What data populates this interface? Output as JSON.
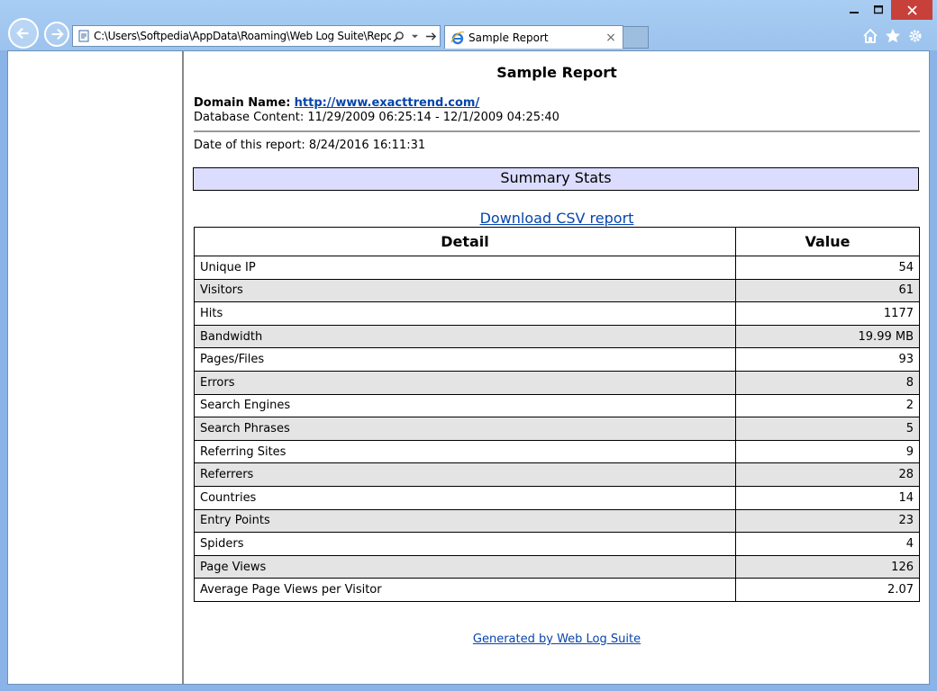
{
  "browser": {
    "address": "C:\\Users\\Softpedia\\AppData\\Roaming\\Web Log Suite\\Reports",
    "tab_title": "Sample Report",
    "tab_close": "×",
    "window": {
      "minimize": "🗕",
      "maximize": "🗖",
      "close": "✕"
    },
    "colors": {
      "frame": "#9cc3ee",
      "close": "#c7403a"
    }
  },
  "report": {
    "title": "Sample Report",
    "domain_label": "Domain Name:",
    "domain_url": "http://www.exacttrend.com/",
    "db_content": "Database Content: 11/29/2009 06:25:14 - 12/1/2009 04:25:40",
    "date_line": "Date of this report: 8/24/2016 16:11:31",
    "summary_heading": "Summary Stats",
    "csv_link": "Download CSV report",
    "columns": [
      "Detail",
      "Value"
    ],
    "rows": [
      {
        "detail": "Unique IP",
        "value": "54"
      },
      {
        "detail": "Visitors",
        "value": "61"
      },
      {
        "detail": "Hits",
        "value": "1177"
      },
      {
        "detail": "Bandwidth",
        "value": "19.99 MB"
      },
      {
        "detail": "Pages/Files",
        "value": "93"
      },
      {
        "detail": "Errors",
        "value": "8"
      },
      {
        "detail": "Search Engines",
        "value": "2"
      },
      {
        "detail": "Search Phrases",
        "value": "5"
      },
      {
        "detail": "Referring Sites",
        "value": "9"
      },
      {
        "detail": "Referrers",
        "value": "28"
      },
      {
        "detail": "Countries",
        "value": "14"
      },
      {
        "detail": "Entry Points",
        "value": "23"
      },
      {
        "detail": "Spiders",
        "value": "4"
      },
      {
        "detail": "Page Views",
        "value": "126"
      },
      {
        "detail": "Average Page Views per Visitor",
        "value": "2.07"
      }
    ],
    "footer": "Generated by Web Log Suite"
  }
}
